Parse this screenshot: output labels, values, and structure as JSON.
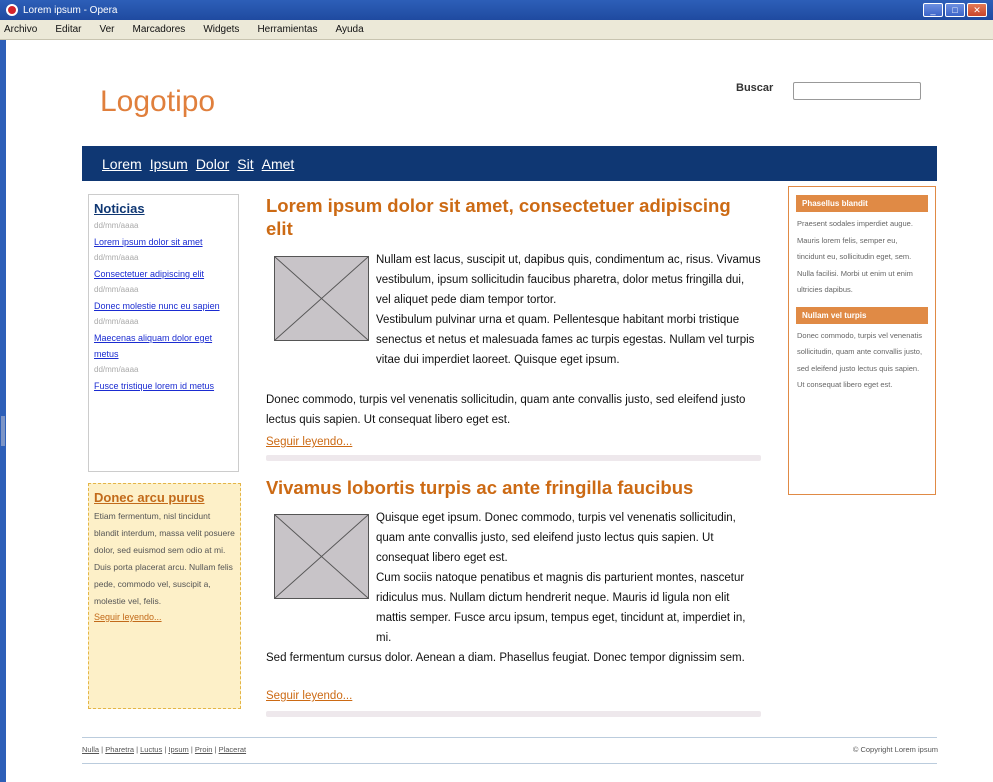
{
  "window": {
    "title": "Lorem ipsum - Opera"
  },
  "menu": [
    "Archivo",
    "Editar",
    "Ver",
    "Marcadores",
    "Widgets",
    "Herramientas",
    "Ayuda"
  ],
  "header": {
    "logo": "Logotipo",
    "search_label": "Buscar",
    "search_value": ""
  },
  "nav": [
    "Lorem",
    "Ipsum",
    "Dolor",
    "Sit",
    "Amet"
  ],
  "news": {
    "title": "Noticias",
    "items": [
      {
        "date": "dd/mm/aaaa",
        "link": "Lorem ipsum dolor sit amet"
      },
      {
        "date": "dd/mm/aaaa",
        "link": "Consectetuer adipiscing elit"
      },
      {
        "date": "dd/mm/aaaa",
        "link": "Donec molestie nunc eu sapien"
      },
      {
        "date": "dd/mm/aaaa",
        "link": "Maecenas aliquam dolor eget metus"
      },
      {
        "date": "dd/mm/aaaa",
        "link": "Fusce tristique lorem id metus"
      }
    ]
  },
  "promo": {
    "title": "Donec arcu purus",
    "text1": "Etiam fermentum, nisl tincidunt blandit interdum, massa velit posuere dolor, sed euismod sem odio at mi.",
    "text2": "Duis porta placerat arcu. Nullam felis pede, commodo vel, suscipit a, molestie vel, felis.",
    "link": "Seguir leyendo..."
  },
  "articles": [
    {
      "title": "Lorem ipsum dolor sit amet, consectetuer adipiscing elit",
      "p1": "Nullam est lacus, suscipit ut, dapibus quis, condimentum ac, risus. Vivamus vestibulum, ipsum sollicitudin faucibus pharetra, dolor metus fringilla dui, vel aliquet pede diam tempor tortor.",
      "p2": "Vestibulum pulvinar urna et quam. Pellentesque habitant morbi tristique senectus et netus et malesuada fames ac turpis egestas. Nullam vel turpis vitae dui imperdiet laoreet. Quisque eget ipsum.",
      "p3": "Donec commodo, turpis vel venenatis sollicitudin, quam ante convallis justo, sed eleifend justo lectus quis sapien. Ut consequat libero eget est.",
      "link": "Seguir leyendo..."
    },
    {
      "title": "Vivamus lobortis turpis ac ante fringilla faucibus",
      "p1": "Quisque eget ipsum. Donec commodo, turpis vel venenatis sollicitudin, quam ante convallis justo, sed eleifend justo lectus quis sapien. Ut consequat libero eget est.",
      "p2": "Cum sociis natoque penatibus et magnis dis parturient montes, nascetur ridiculus mus. Nullam dictum hendrerit neque. Mauris id ligula non elit mattis semper. Fusce arcu ipsum, tempus eget, tincidunt at, imperdiet in, mi.",
      "p3": "Sed fermentum cursus dolor. Aenean a diam. Phasellus feugiat. Donec tempor dignissim sem.",
      "link": "Seguir leyendo..."
    }
  ],
  "right": {
    "h1": "Phasellus blandit",
    "t1": "Praesent sodales imperdiet augue. Mauris lorem felis, semper eu, tincidunt eu, sollicitudin eget, sem. Nulla facilisi. Morbi ut enim ut enim ultricies dapibus.",
    "h2": "Nullam vel turpis",
    "t2": "Donec commodo, turpis vel venenatis sollicitudin, quam ante convallis justo, sed eleifend justo lectus quis sapien. Ut consequat libero eget est."
  },
  "footer": {
    "links": [
      "Nulla",
      "Pharetra",
      "Luctus",
      "Ipsum",
      "Proin",
      "Placerat"
    ],
    "copyright": "© Copyright Lorem ipsum"
  }
}
